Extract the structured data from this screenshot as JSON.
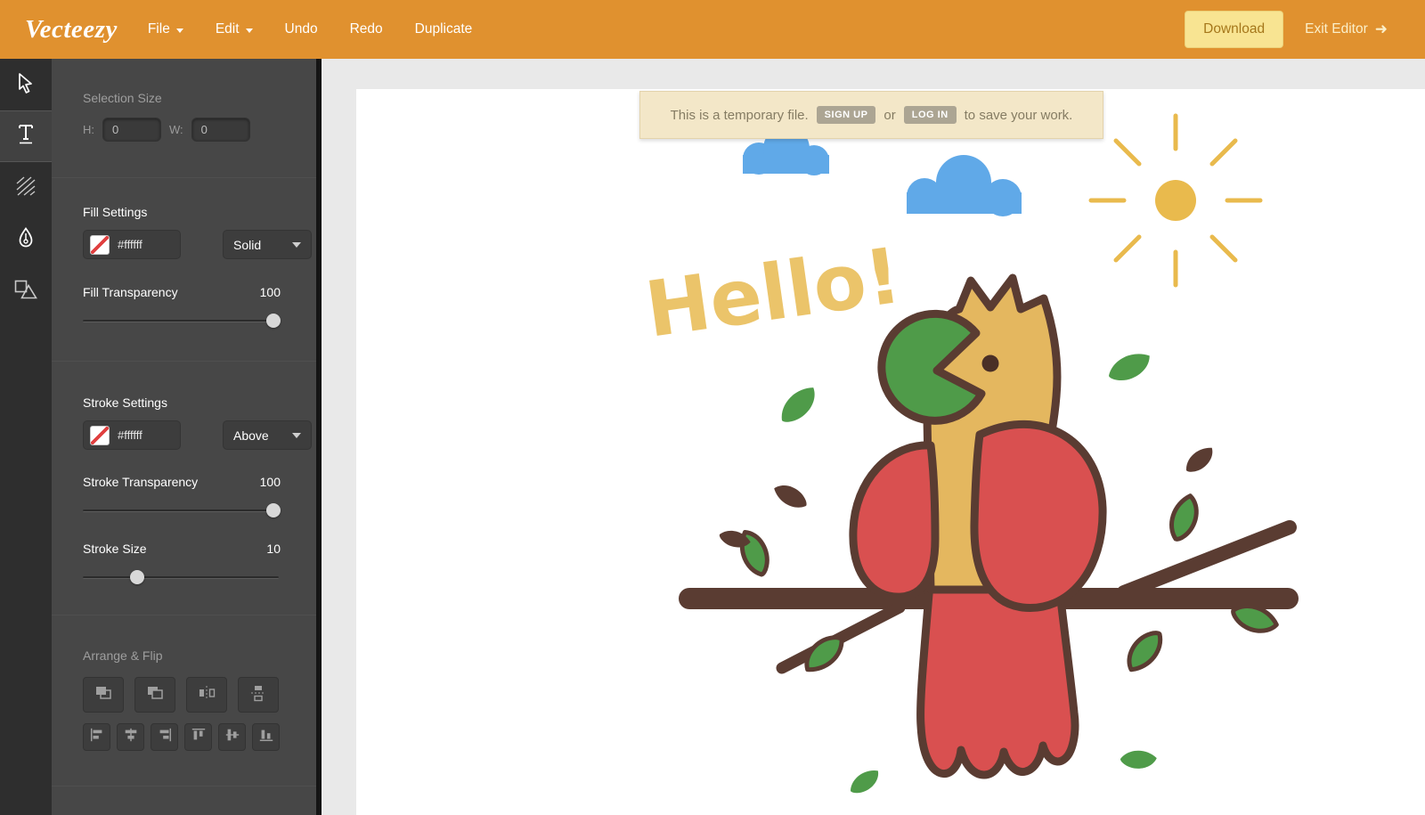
{
  "topbar": {
    "logo": "Vecteezy",
    "menu_file": "File",
    "menu_edit": "Edit",
    "menu_undo": "Undo",
    "menu_redo": "Redo",
    "menu_duplicate": "Duplicate",
    "download": "Download",
    "exit": "Exit Editor",
    "exit_arrow": "➜"
  },
  "panel": {
    "selection_size_title": "Selection Size",
    "h_label": "H:",
    "h_value": "0",
    "w_label": "W:",
    "w_value": "0",
    "fill_title": "Fill Settings",
    "fill_color": "#ffffff",
    "fill_style": "Solid",
    "fill_transparency_label": "Fill Transparency",
    "fill_transparency_value": "100",
    "stroke_title": "Stroke Settings",
    "stroke_color": "#ffffff",
    "stroke_position": "Above",
    "stroke_transparency_label": "Stroke Transparency",
    "stroke_transparency_value": "100",
    "stroke_size_label": "Stroke Size",
    "stroke_size_value": "10",
    "arrange_title": "Arrange & Flip"
  },
  "banner": {
    "prefix": "This is a temporary file.",
    "signup": "SIGN UP",
    "middle": "or",
    "login": "LOG IN",
    "suffix": "to save your work."
  },
  "illustration": {
    "greeting": "Hello!"
  },
  "colors": {
    "topbar_orange": "#E0912F",
    "gold": "#EBC46A",
    "parrot_red": "#D95050",
    "parrot_green": "#4F9B49",
    "parrot_gold": "#E4B75F",
    "outline_brown": "#5A3C32",
    "sky_blue": "#60A9E8",
    "sun_gold": "#E9BA4D"
  }
}
